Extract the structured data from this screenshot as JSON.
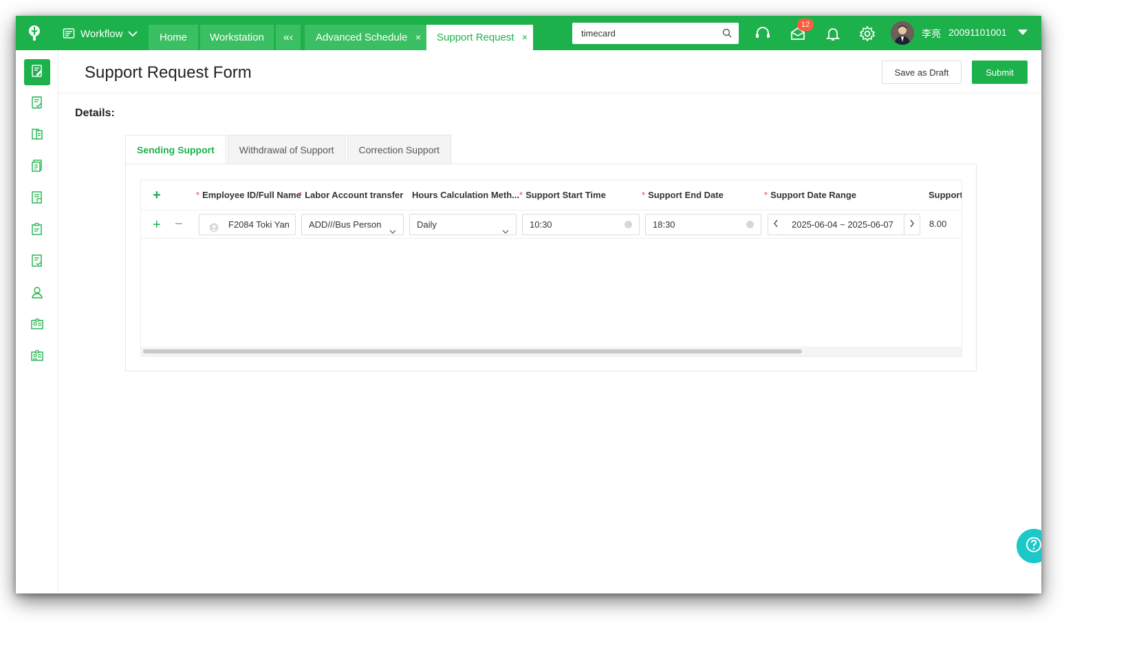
{
  "topbar": {
    "workflow_label": "Workflow",
    "tabs": [
      {
        "label": "Home"
      },
      {
        "label": "Workstation"
      },
      {
        "label": "«‹"
      },
      {
        "label": "Advanced Schedule",
        "close": "×"
      },
      {
        "label": "Support Request",
        "close": "×"
      }
    ],
    "search": {
      "value": "timecard",
      "placeholder": ""
    },
    "notification_count": "12",
    "user": {
      "name": "李亮",
      "id": "20091101001"
    },
    "icons": [
      "headset-icon",
      "mail-icon",
      "bell-icon",
      "gear-icon"
    ]
  },
  "sidebar": {
    "items": [
      "form-edit-icon",
      "form-check-icon",
      "document-icon",
      "copy-document-icon",
      "report-icon",
      "clipboard-icon",
      "checklist-icon",
      "user-icon",
      "id-card-icon",
      "profile-card-icon"
    ]
  },
  "header": {
    "title": "Support Request Form",
    "save_draft": "Save as Draft",
    "submit": "Submit"
  },
  "details": {
    "label": "Details:",
    "tabs": [
      {
        "label": "Sending Support",
        "active": true
      },
      {
        "label": "Withdrawal of Support",
        "active": false
      },
      {
        "label": "Correction Support",
        "active": false
      }
    ],
    "columns": [
      {
        "label": "Employee ID/Full Name",
        "required": "*"
      },
      {
        "label": "Labor Account transfer",
        "required": "*"
      },
      {
        "label": "Hours Calculation Meth...",
        "required": ""
      },
      {
        "label": "Support Start Time",
        "required": "*"
      },
      {
        "label": "Support End Date",
        "required": "*"
      },
      {
        "label": "Support Date Range",
        "required": "*"
      },
      {
        "label": "Support",
        "required": ""
      }
    ],
    "add_symbol": "+",
    "remove_symbol": "−",
    "row": {
      "employee": "F2084 Toki Yan",
      "labor_account": "ADD///Bus Person",
      "hours_method": "Daily",
      "start_time": "10:30",
      "end_date": "18:30",
      "date_range": "2025-06-04 ~ 2025-06-07",
      "support_hours": "8.00"
    }
  },
  "colors": {
    "brand": "#1db14b",
    "help": "#1cc8c8",
    "badge": "#ff5a3c"
  }
}
